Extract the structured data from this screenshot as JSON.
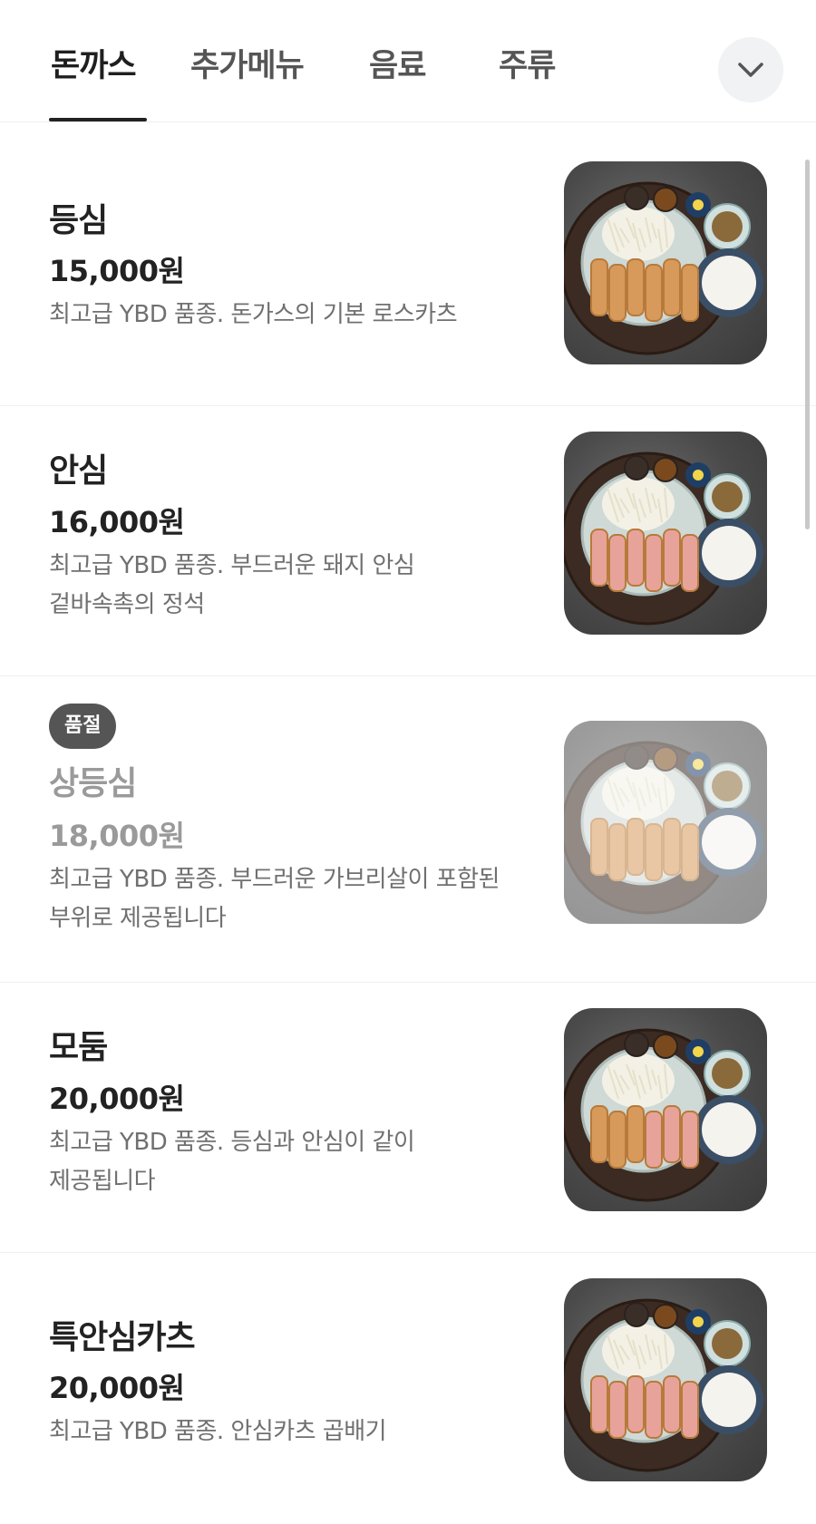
{
  "tabs": [
    {
      "label": "돈까스",
      "active": true
    },
    {
      "label": "추가메뉴",
      "active": false
    },
    {
      "label": "음료",
      "active": false
    },
    {
      "label": "주류",
      "active": false
    }
  ],
  "expand_icon": "chevron-down-icon",
  "items": [
    {
      "name": "등심",
      "price": "15,000원",
      "desc_lines": [
        "최고급 YBD 품종. 돈가스의 기본 로스카츠"
      ],
      "sold_out": false,
      "cutlet": "fried"
    },
    {
      "name": "안심",
      "price": "16,000원",
      "desc_lines": [
        "최고급 YBD 품종. 부드러운 돼지 안심",
        "겉바속촉의 정석"
      ],
      "sold_out": false,
      "cutlet": "pink"
    },
    {
      "name": "상등심",
      "price": "18,000원",
      "desc_lines": [
        "최고급 YBD 품종. 부드러운 가브리살이 포함된",
        "부위로 제공됩니다"
      ],
      "sold_out": true,
      "badge": "품절",
      "cutlet": "fried"
    },
    {
      "name": "모둠",
      "price": "20,000원",
      "desc_lines": [
        "최고급 YBD 품종. 등심과 안심이 같이",
        "제공됩니다"
      ],
      "sold_out": false,
      "cutlet": "mixed"
    },
    {
      "name": "특안심카츠",
      "price": "20,000원",
      "desc_lines": [
        "최고급 YBD 품종. 안심카츠 곱배기"
      ],
      "sold_out": false,
      "cutlet": "pink"
    }
  ],
  "colors": {
    "text": "#222222",
    "muted": "#707070",
    "soldout": "#9a9a9a",
    "badge_bg": "#555555"
  }
}
